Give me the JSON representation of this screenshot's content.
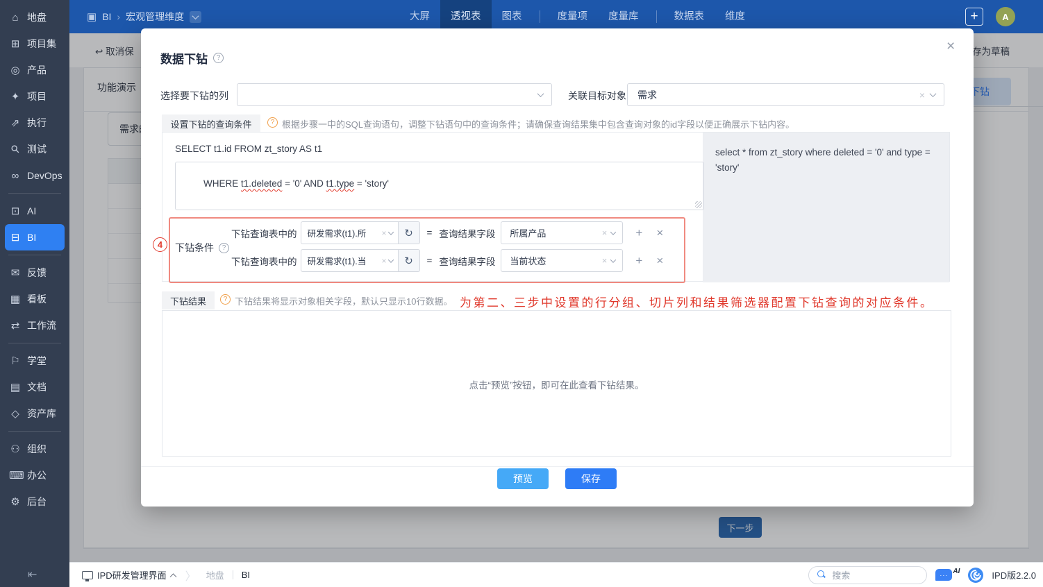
{
  "colors": {
    "navbar": "#1d57ab",
    "navbar_active_tab": "#15427f",
    "sidebar": "#333e51",
    "sidebar_active": "#2f80f2",
    "primary": "#2e7cf6",
    "preview_btn": "#45a9f7",
    "annotation_red": "#e0372a",
    "red_border": "#f08a80",
    "avatar_bg": "#93a254"
  },
  "sidebar": {
    "items": [
      {
        "icon": "⌂",
        "label": "地盘"
      },
      {
        "icon": "⊞",
        "label": "项目集"
      },
      {
        "icon": "◎",
        "label": "产品"
      },
      {
        "icon": "✦",
        "label": "项目"
      },
      {
        "icon": "⇗",
        "label": "执行"
      },
      {
        "icon": "⚲",
        "label": "测试"
      },
      {
        "icon": "∞",
        "label": "DevOps"
      },
      {
        "icon": "⊡",
        "label": "AI"
      },
      {
        "icon": "⊟",
        "label": "BI"
      },
      {
        "icon": "✉",
        "label": "反馈"
      },
      {
        "icon": "▦",
        "label": "看板"
      },
      {
        "icon": "⇄",
        "label": "工作流"
      },
      {
        "icon": "⚐",
        "label": "学堂"
      },
      {
        "icon": "▤",
        "label": "文档"
      },
      {
        "icon": "◇",
        "label": "资产库"
      },
      {
        "icon": "⚇",
        "label": "组织"
      },
      {
        "icon": "⌨",
        "label": "办公"
      },
      {
        "icon": "⚙",
        "label": "后台"
      }
    ],
    "collapse_icon": "⇤"
  },
  "navbar": {
    "breadcrumb": {
      "icon": "▣",
      "app": "BI",
      "sep": "›",
      "page": "宏观管理维度"
    },
    "tabs": [
      {
        "label": "大屏"
      },
      {
        "label": "透视表"
      },
      {
        "label": "图表"
      },
      {
        "label": "度量项"
      },
      {
        "label": "度量库"
      },
      {
        "label": "数据表"
      },
      {
        "label": "维度"
      }
    ],
    "plus": "+",
    "avatar": "A"
  },
  "background": {
    "back_icon": "↩",
    "cancel_save": "取消保",
    "save_draft": "存为草稿",
    "tab": "功能演示",
    "drill_button": "下钻",
    "input_partial": "需求的",
    "next_button": "下一步"
  },
  "modal": {
    "title": "数据下钻",
    "close_icon": "×",
    "help_glyph": "?",
    "drill_column_label": "选择要下钻的列",
    "target_label": "关联目标对象",
    "target_value": "需求",
    "clear_icon": "×",
    "query_tab": "设置下钻的查询条件",
    "query_hint": "根据步骤一中的SQL查询语句，调整下钻语句中的查询条件；请确保查询结果集中包含查询对象的id字段以便正确展示下钻内容。",
    "sql_select_line": "SELECT t1.id FROM zt_story AS t1",
    "sql_where": {
      "p0": "WHERE ",
      "w1": "t1.deleted",
      "p2": " = '0' AND ",
      "w3": "t1.type",
      "p4": " = 'story'"
    },
    "sql_preview": "select * from zt_story where deleted = '0' and type = 'story'",
    "step_badge": "4",
    "condition_label": "下钻条件",
    "refresh_icon": "↻",
    "plus_icon": "+",
    "delete_icon": "×",
    "equals": "=",
    "rows": [
      {
        "left_label": "下钻查询表中的",
        "left_value": "研发需求(t1).所",
        "right_label": "查询结果字段",
        "right_value": "所属产品"
      },
      {
        "left_label": "下钻查询表中的",
        "left_value": "研发需求(t1).当",
        "right_label": "查询结果字段",
        "right_value": "当前状态"
      }
    ],
    "result_tab": "下钻结果",
    "result_hint": "下钻结果将显示对象相关字段，默认只显示10行数据。",
    "annotation": "为第二、三步中设置的行分组、切片列和结果筛选器配置下钻查询的对应条件。",
    "result_empty": "点击“预览”按钮，即可在此查看下钻结果。",
    "preview_button": "预览",
    "save_button": "保存"
  },
  "taskbar": {
    "app": "IPD研发管理界面",
    "sep": "〉",
    "crumb1": "地盘",
    "crumb2": "BI",
    "search_placeholder": "搜索",
    "ai_dots": "···",
    "ai_label": "AI",
    "version": "IPD版2.2.0"
  }
}
